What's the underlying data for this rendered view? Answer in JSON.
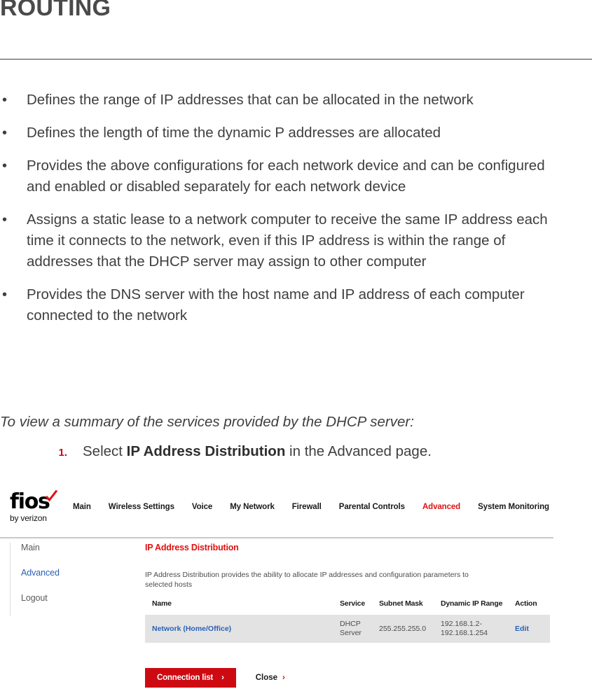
{
  "page": {
    "title": "ROUTING"
  },
  "bullets": [
    {
      "marker": "•",
      "text": "Defines the range of IP addresses that can be allocated in the network"
    },
    {
      "marker": "•",
      "text": "Defines the length of time the dynamic P addresses are allocated"
    },
    {
      "marker": "•",
      "text": "Provides the above configurations for each network device and can be configured and enabled or disabled separately for each network device"
    },
    {
      "marker": "•",
      "text": "Assigns a static lease to a network computer to receive the same IP address each time it connects to the network, even if this IP address is within the range of addresses that the DHCP server may assign to other computer"
    },
    {
      "marker": "•",
      "text": "Provides the DNS server with the host name and IP address of each computer connected to the network"
    }
  ],
  "lead_in": "To view a summary of the services provided by the DHCP server:",
  "step": {
    "number": "1.",
    "number_color": "#d0021b",
    "prefix": "Select ",
    "emphasis": "IP Address Distribution",
    "suffix": " in the Advanced page."
  },
  "screenshot": {
    "logo": {
      "word": "fios",
      "subtitle": "by verizon",
      "check_color": "#e01010"
    },
    "topnav": {
      "items": [
        {
          "label": "Main",
          "active": false
        },
        {
          "label": "Wireless Settings",
          "active": false
        },
        {
          "label": "Voice",
          "active": false
        },
        {
          "label": "My Network",
          "active": false
        },
        {
          "label": "Firewall",
          "active": false
        },
        {
          "label": "Parental Controls",
          "active": false
        },
        {
          "label": "Advanced",
          "active": true
        },
        {
          "label": "System Monitoring",
          "active": false
        }
      ],
      "active_color": "#e01010"
    },
    "sidebar": {
      "items": [
        {
          "label": "Main",
          "link": false
        },
        {
          "label": "Advanced",
          "link": true
        },
        {
          "label": "Logout",
          "link": false
        }
      ],
      "link_color": "#2b61b5"
    },
    "panel": {
      "title": "IP Address Distribution",
      "title_color": "#e01010",
      "description": "IP Address Distribution provides the ability to allocate IP addresses and configuration parameters to selected hosts",
      "table": {
        "headers": [
          "Name",
          "Service",
          "Subnet Mask",
          "Dynamic IP Range",
          "Action"
        ],
        "rows": [
          {
            "name": "Network (Home/Office)",
            "service": "DHCP Server",
            "subnet_mask": "255.255.255.0",
            "dynamic_ip_range": "192.168.1.2-192.168.1.254",
            "action": "Edit"
          }
        ],
        "row_background": "#e3e3e3"
      },
      "buttons": {
        "primary": {
          "label": "Connection list",
          "chevron": "›",
          "background": "#cd0a12"
        },
        "secondary": {
          "label": "Close",
          "chevron": "›",
          "chevron_color": "#e01010"
        }
      }
    }
  }
}
